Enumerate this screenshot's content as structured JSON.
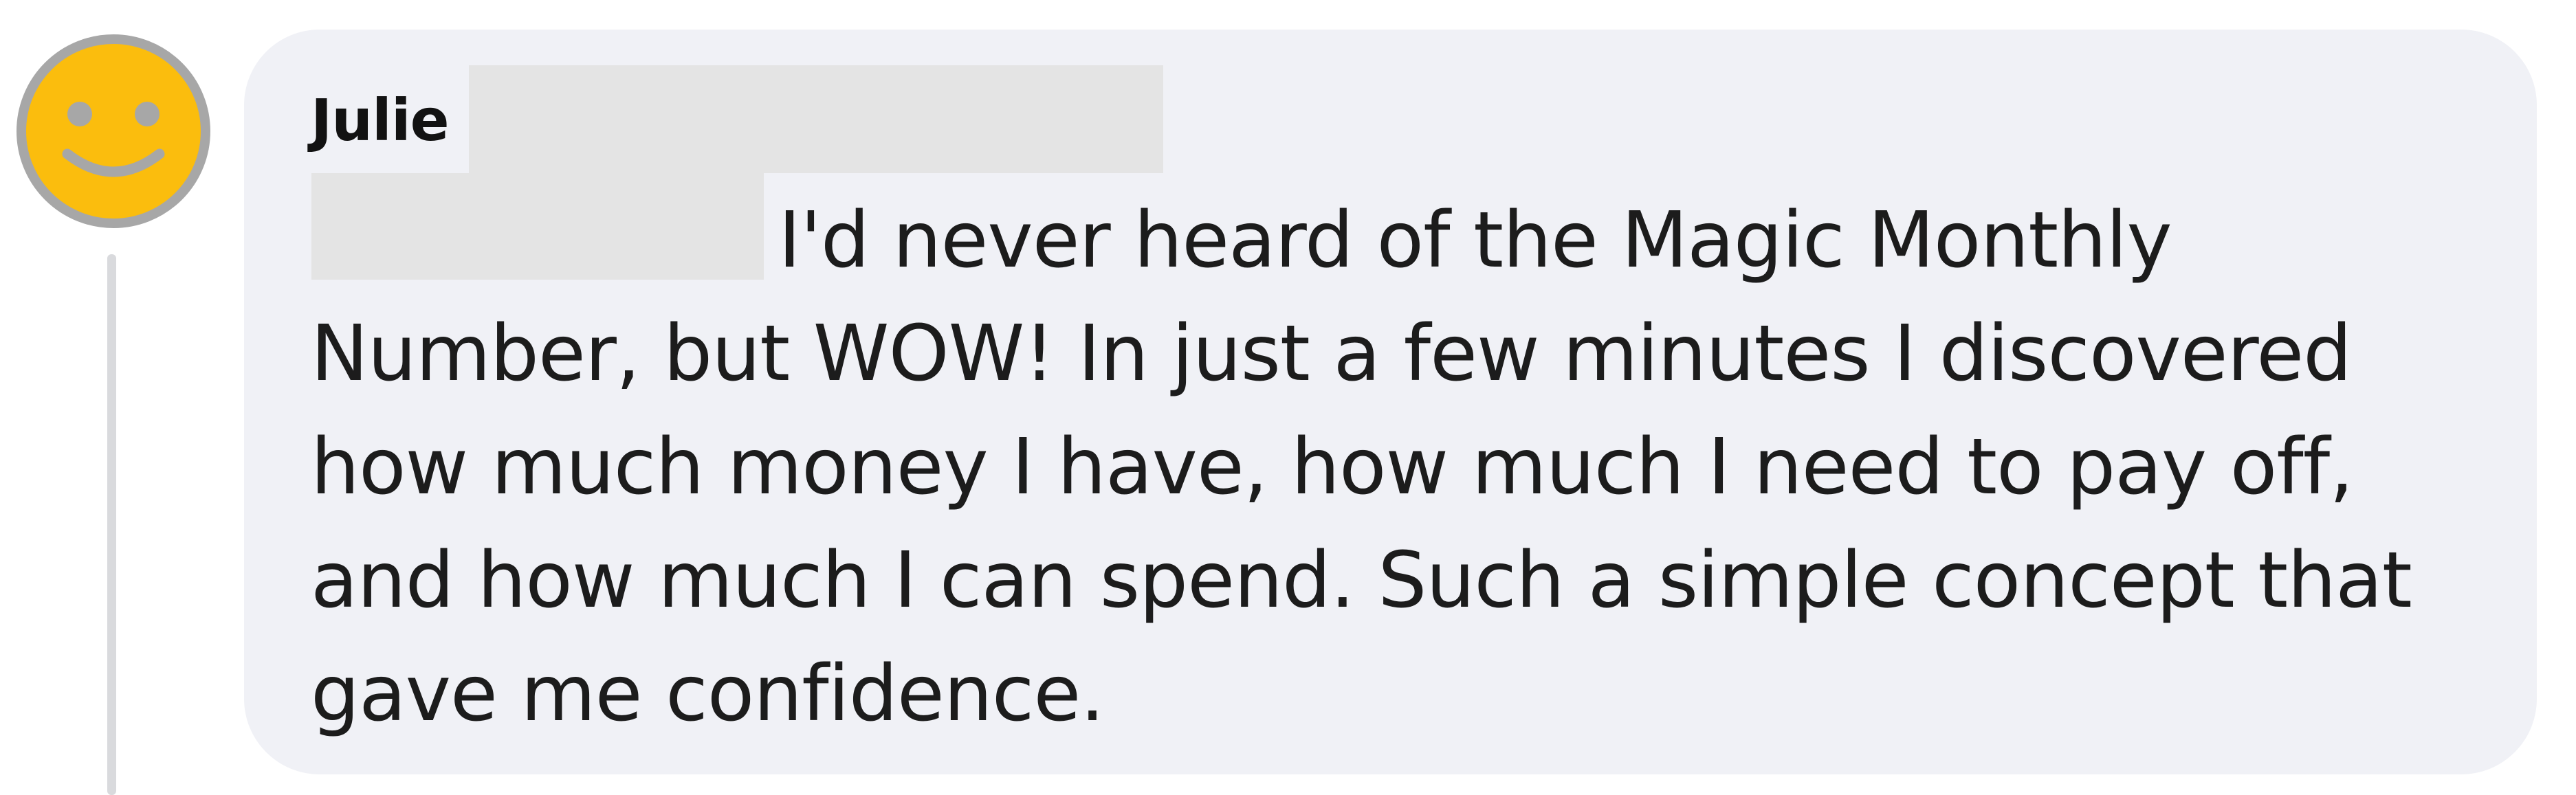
{
  "comment": {
    "author": "Julie",
    "text": "I'd never heard of the Magic Monthly Number, but WOW! In just a few minutes I discovered how much money I have, how much I need to pay off, and how much I can spend. Such a simple concept that gave me confidence."
  },
  "avatar": {
    "icon": "smiley-face-icon",
    "fill_color": "#fbbd0d",
    "ring_color": "#a7a7a7"
  },
  "colors": {
    "bubble": "#f0f1f6",
    "text": "#1c1c1c",
    "redaction": "#e4e4e4",
    "thread_line": "#d9dadd"
  }
}
